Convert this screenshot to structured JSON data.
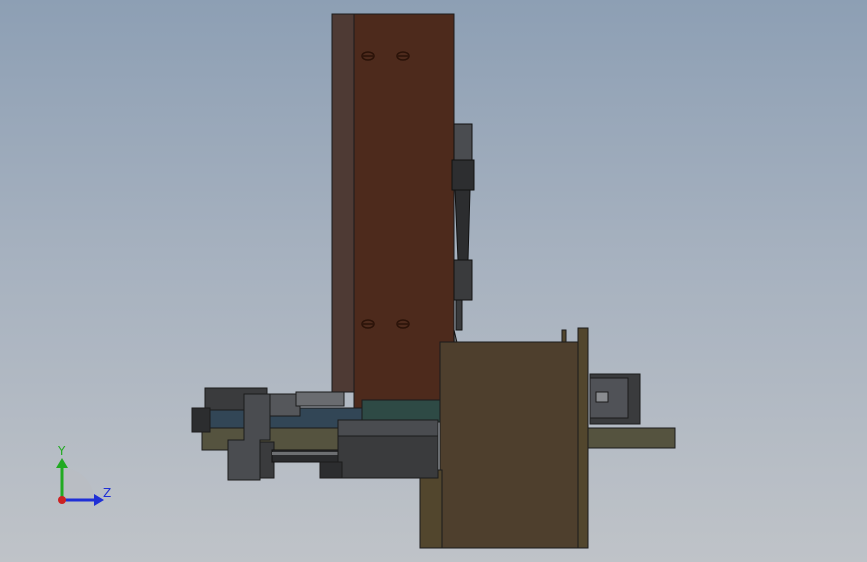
{
  "triad": {
    "y_label": "Y",
    "z_label": "Z",
    "y_color": "#22aa22",
    "z_color": "#1f2fd6",
    "origin_color": "#cc2222"
  },
  "colors": {
    "brown_plate": "#4d2a1c",
    "brown_plate_side": "#4e3a34",
    "olive_box": "#4e3f2d",
    "olive_frame": "#52462d",
    "dark_steel": "#3a3b3d",
    "mid_steel": "#55575b",
    "light_steel": "#707276",
    "teal_block": "#2e4a45",
    "blue_plate": "#324656",
    "outline": "#1b1b1b"
  }
}
